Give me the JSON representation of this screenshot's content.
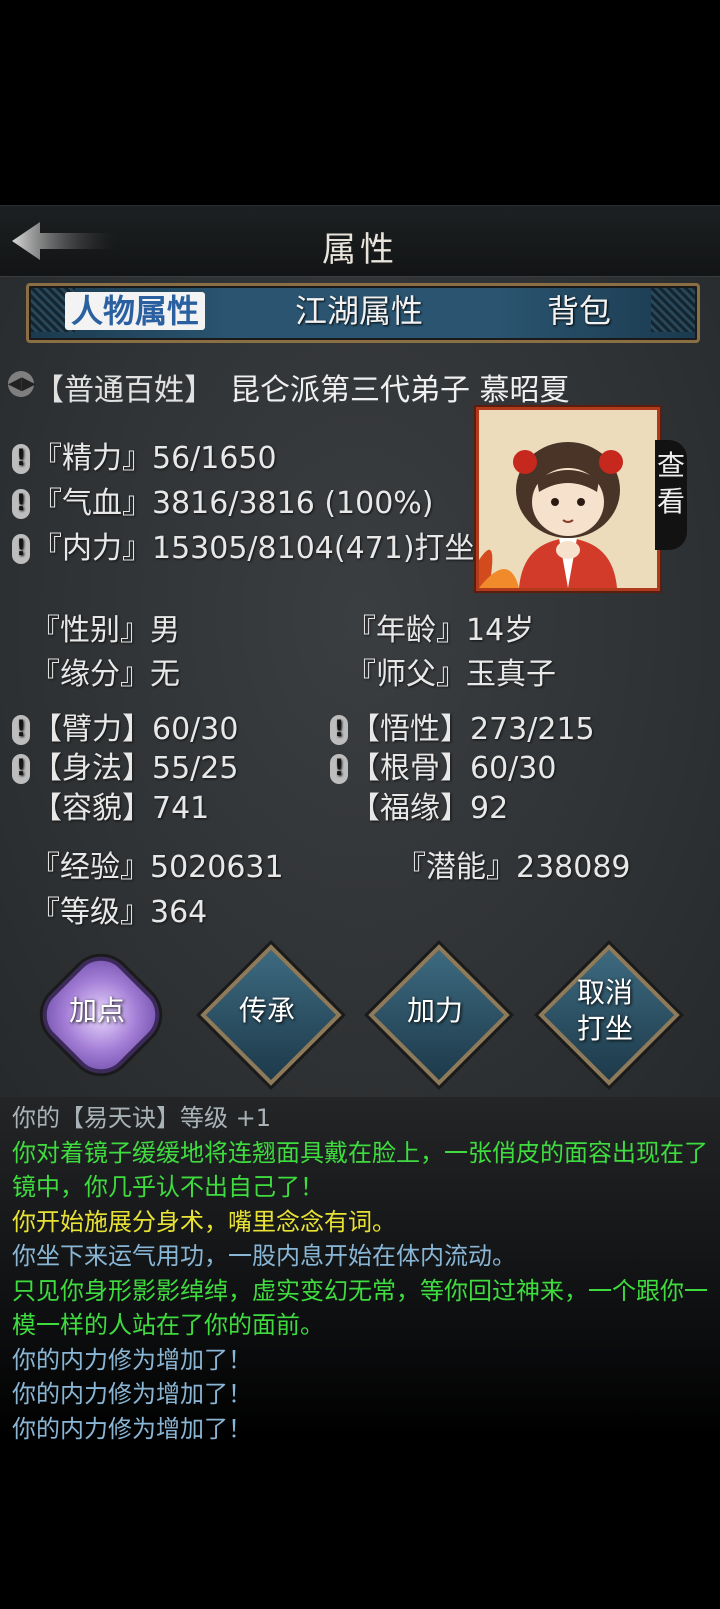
{
  "header": {
    "title": "属性"
  },
  "tabs": [
    {
      "label": "人物属性",
      "active": true
    },
    {
      "label": "江湖属性",
      "active": false
    },
    {
      "label": "背包",
      "active": false
    }
  ],
  "rank": {
    "icon": "speaker-icon",
    "label": "【普通百姓】"
  },
  "identity": "昆仑派第三代弟子 慕昭夏",
  "vitals": [
    {
      "label": "『精力』",
      "value": "56/1650"
    },
    {
      "label": "『气血』",
      "value": "3816/3816 (100%)"
    },
    {
      "label": "『内力』",
      "value": "15305/8104(471)打坐"
    }
  ],
  "view_button": "查\n看",
  "info": {
    "gender": {
      "label": "『性别』",
      "value": "男"
    },
    "age": {
      "label": "『年龄』",
      "value": "14岁"
    },
    "fate": {
      "label": "『缘分』",
      "value": "无"
    },
    "master": {
      "label": "『师父』",
      "value": "玉真子"
    }
  },
  "attributes": {
    "strength": {
      "label": "【臂力】",
      "value": "60/30"
    },
    "comprehension": {
      "label": "【悟性】",
      "value": "273/215"
    },
    "agility": {
      "label": "【身法】",
      "value": "55/25"
    },
    "constitution": {
      "label": "【根骨】",
      "value": "60/30"
    },
    "appearance": {
      "label": "【容貌】",
      "value": "741"
    },
    "fortune": {
      "label": "【福缘】",
      "value": "92"
    }
  },
  "progress": {
    "exp": {
      "label": "『经验』",
      "value": "5020631"
    },
    "potential": {
      "label": "『潜能』",
      "value": "238089"
    },
    "level": {
      "label": "『等级』",
      "value": "364"
    }
  },
  "actions": [
    {
      "label": "加点"
    },
    {
      "label": "传承"
    },
    {
      "label": "加力"
    },
    {
      "label": "取消\n打坐"
    }
  ],
  "log": [
    {
      "text": "你的【易天诀】等级 +1",
      "color": "gray"
    },
    {
      "text": "你对着镜子缓缓地将连翘面具戴在脸上，一张俏皮的面容出现在了镜中，你几乎认不出自己了！",
      "color": "green"
    },
    {
      "text": "你开始施展分身术，嘴里念念有词。",
      "color": "yellow"
    },
    {
      "text": "你坐下来运气用功，一股内息开始在体内流动。",
      "color": "blue"
    },
    {
      "text": "只见你身形影影绰绰，虚实变幻无常，等你回过神来，一个跟你一模一样的人站在了你的面前。",
      "color": "green"
    },
    {
      "text": "你的内力修为增加了！",
      "color": "blue"
    },
    {
      "text": "你的内力修为增加了！",
      "color": "blue"
    },
    {
      "text": "你的内力修为增加了！",
      "color": "blue"
    }
  ],
  "colors": {
    "active_tab_text": "#2a5fa0",
    "log_green": "#3fdc3f",
    "log_yellow": "#e8e234",
    "log_blue": "#8ab6d6"
  }
}
